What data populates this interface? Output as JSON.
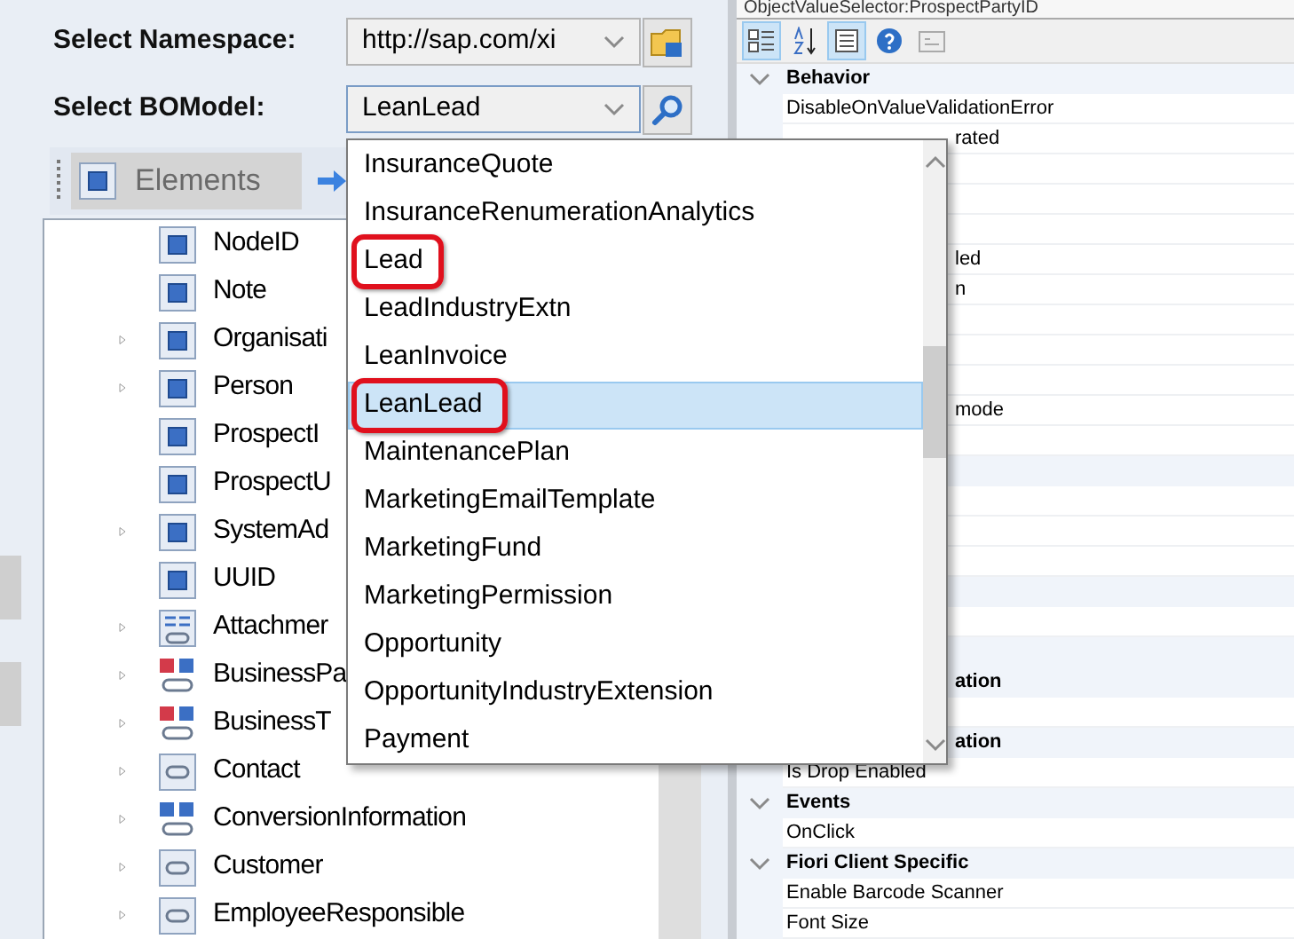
{
  "selectors": [
    {
      "label": "Select Namespace:",
      "value": "http://sap.com/xi",
      "kind": "folder"
    },
    {
      "label": "Select BOModel:",
      "value": "LeanLead",
      "kind": "search",
      "expanded": true
    }
  ],
  "toolbar": {
    "tab": "Elements"
  },
  "tree": [
    {
      "label": "NodeID",
      "kind": "element",
      "expandable": false
    },
    {
      "label": "Note",
      "kind": "element",
      "expandable": false
    },
    {
      "label": "Organisati",
      "kind": "element",
      "expandable": true
    },
    {
      "label": "Person",
      "kind": "element",
      "expandable": true
    },
    {
      "label": "ProspectI",
      "kind": "element",
      "expandable": false
    },
    {
      "label": "ProspectU",
      "kind": "element",
      "expandable": false
    },
    {
      "label": "SystemAd",
      "kind": "element",
      "expandable": true
    },
    {
      "label": "UUID",
      "kind": "element",
      "expandable": false
    },
    {
      "label": "Attachmer",
      "kind": "list-link",
      "expandable": true
    },
    {
      "label": "BusinessPa",
      "kind": "red-link",
      "expandable": true
    },
    {
      "label": "BusinessT",
      "kind": "red-link",
      "expandable": true
    },
    {
      "label": "Contact",
      "kind": "link",
      "expandable": true
    },
    {
      "label": "ConversionInformation",
      "kind": "blue-link",
      "expandable": true
    },
    {
      "label": "Customer",
      "kind": "link",
      "expandable": true
    },
    {
      "label": "EmployeeResponsible",
      "kind": "link",
      "expandable": true
    }
  ],
  "dropdown": [
    {
      "label": "InsuranceQuote",
      "selected": false,
      "highlighted": false
    },
    {
      "label": "InsuranceRenumerationAnalytics",
      "selected": false,
      "highlighted": false
    },
    {
      "label": "Lead",
      "selected": false,
      "highlighted": true
    },
    {
      "label": "LeadIndustryExtn",
      "selected": false,
      "highlighted": false
    },
    {
      "label": "LeanInvoice",
      "selected": false,
      "highlighted": false
    },
    {
      "label": "LeanLead",
      "selected": true,
      "highlighted": true
    },
    {
      "label": "MaintenancePlan",
      "selected": false,
      "highlighted": false
    },
    {
      "label": "MarketingEmailTemplate",
      "selected": false,
      "highlighted": false
    },
    {
      "label": "MarketingFund",
      "selected": false,
      "highlighted": false
    },
    {
      "label": "MarketingPermission",
      "selected": false,
      "highlighted": false
    },
    {
      "label": "Opportunity",
      "selected": false,
      "highlighted": false
    },
    {
      "label": "OpportunityIndustryExtension",
      "selected": false,
      "highlighted": false
    },
    {
      "label": "Payment",
      "selected": false,
      "highlighted": false
    }
  ],
  "properties": {
    "title": "ObjectValueSelector:ProspectPartyID",
    "tools": [
      {
        "kind": "categorized",
        "selected": true
      },
      {
        "kind": "alphabetical",
        "selected": false
      },
      {
        "kind": "properties",
        "selected": true
      },
      {
        "kind": "help",
        "selected": false
      },
      {
        "kind": "pages",
        "selected": false
      }
    ],
    "rows": [
      {
        "kind": "category",
        "label": "Behavior"
      },
      {
        "kind": "property",
        "label": "DisableOnValueValidationError"
      },
      {
        "kind": "cut",
        "label": "rated"
      },
      {
        "kind": "property"
      },
      {
        "kind": "property"
      },
      {
        "kind": "property"
      },
      {
        "kind": "cut",
        "label": "led"
      },
      {
        "kind": "cut",
        "label": "n"
      },
      {
        "kind": "property"
      },
      {
        "kind": "property"
      },
      {
        "kind": "property"
      },
      {
        "kind": "cut",
        "label": "mode"
      },
      {
        "kind": "property"
      },
      {
        "kind": "category"
      },
      {
        "kind": "property"
      },
      {
        "kind": "property"
      },
      {
        "kind": "property"
      },
      {
        "kind": "category"
      },
      {
        "kind": "property"
      },
      {
        "kind": "category"
      },
      {
        "kind": "category-cut",
        "label": "ation"
      },
      {
        "kind": "property"
      },
      {
        "kind": "category-cut",
        "label": "ation"
      },
      {
        "kind": "property",
        "label": "Is Drop Enabled"
      },
      {
        "kind": "category",
        "label": "Events"
      },
      {
        "kind": "property",
        "label": "OnClick"
      },
      {
        "kind": "category",
        "label": "Fiori Client Specific"
      },
      {
        "kind": "property",
        "label": "Enable Barcode Scanner"
      },
      {
        "kind": "property",
        "label": "Font Size"
      }
    ]
  }
}
